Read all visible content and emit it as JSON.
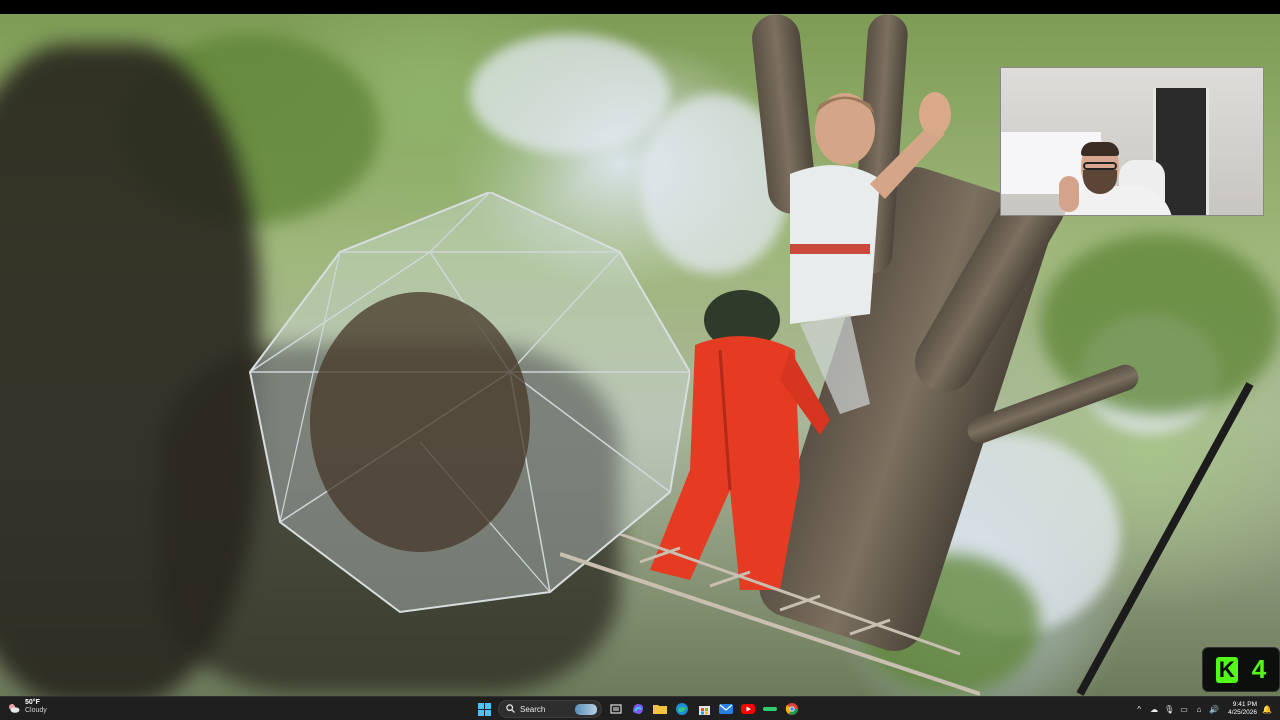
{
  "taskbar": {
    "weather": {
      "temp": "50°F",
      "condition": "Cloudy"
    },
    "search": {
      "label": "Search"
    },
    "clock": {
      "time": "9:41 PM",
      "date": "4/25/2026"
    },
    "tray": {
      "chevron": "^",
      "notification_count": ""
    }
  },
  "overlay": {
    "kick_badge": {
      "letter": "K",
      "number": "4",
      "color": "#53fc18"
    }
  },
  "icons": {
    "start": "windows-logo-icon",
    "task_view": "task-view-icon",
    "copilot": "copilot-icon",
    "explorer": "folder-icon",
    "edge": "edge-browser-icon",
    "store": "store-icon",
    "mail": "mail-icon",
    "youtube": "youtube-icon",
    "app_green": "green-app-icon",
    "chrome": "chrome-icon"
  }
}
